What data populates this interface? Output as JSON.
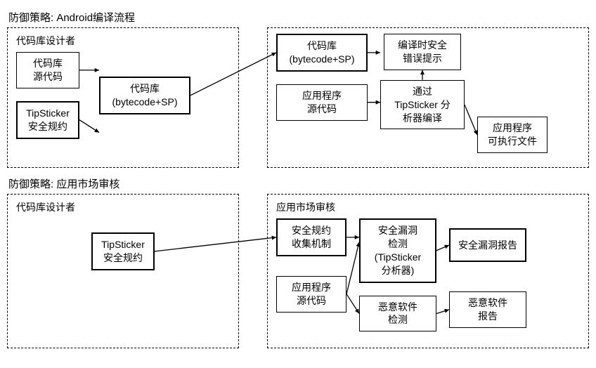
{
  "section1": {
    "title": "防御策略: Android编译流程",
    "leftPanelLabel": "代码库设计者",
    "rightPanelLabel": "",
    "boxes": {
      "srcCodeLib": "代码库\n源代码",
      "tipStickerSpec": "TipSticker\n安全规约",
      "codeLibBytecode": "代码库\n(bytecode+SP)",
      "codeLibBytecode2": "代码库\n(bytecode+SP)",
      "appSrc": "应用程序\n源代码",
      "compileViaTip": "通过\nTipSticker 分\n析器编译",
      "compileError": "编译时安全\n错误提示",
      "appExe": "应用程序\n可执行文件"
    }
  },
  "section2": {
    "title": "防御策略: 应用市场审核",
    "leftPanelLabel": "代码库设计者",
    "rightPanelLabel": "应用市场审核",
    "boxes": {
      "tipStickerSpec2": "TipSticker\n安全规约",
      "specCollect": "安全规约\n收集机制",
      "appSrc2": "应用程序\n源代码",
      "vulnDetect": "安全漏洞\n检测\n(TipSticker\n分析器)",
      "vulnReport": "安全漏洞报告",
      "malwareDetect": "恶意软件\n检测",
      "malwareReport": "恶意软件\n报告"
    }
  }
}
